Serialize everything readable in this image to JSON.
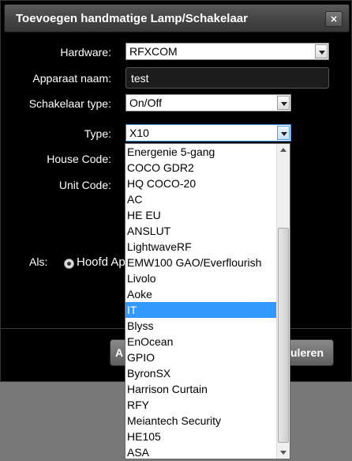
{
  "dialog": {
    "title": "Toevoegen handmatige Lamp/Schakelaar",
    "close_label": "×"
  },
  "form": {
    "hardware_label": "Hardware:",
    "hardware_value": "RFXCOM",
    "name_label": "Apparaat naam:",
    "name_value": "test",
    "switch_type_label": "Schakelaar type:",
    "switch_type_value": "On/Off",
    "type_label": "Type:",
    "type_value": "X10",
    "house_code_label": "House Code:",
    "unit_code_label": "Unit Code:",
    "als_label": "Als:",
    "radio_main_label": "Hoofd Ap"
  },
  "buttons": {
    "left_label": "A",
    "right_label": "uleren"
  },
  "dropdown": {
    "selected": "IT",
    "items": [
      "Energenie 5-gang",
      "COCO GDR2",
      "HQ COCO-20",
      "AC",
      "HE EU",
      "ANSLUT",
      "LightwaveRF",
      "EMW100 GAO/Everflourish",
      "Livolo",
      "Aoke",
      "IT",
      "Blyss",
      "EnOcean",
      "GPIO",
      "ByronSX",
      "Harrison Curtain",
      "RFY",
      "Meiantech Security",
      "HE105",
      "ASA"
    ]
  },
  "colors": {
    "dialog_bg": "#000000",
    "overlay": "#787878",
    "selection": "#3399ff"
  }
}
